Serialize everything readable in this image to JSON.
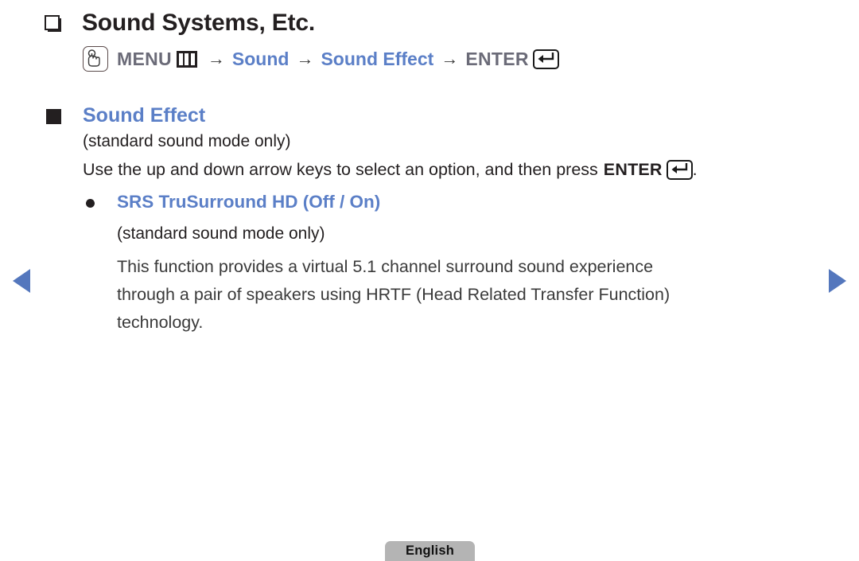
{
  "page": {
    "title": "Sound Systems, Etc.",
    "title_bullet_icon": "hollow-square-bullet-icon"
  },
  "breadcrumb": {
    "touch_icon": "hand-touch-icon",
    "menu_label": "MENU",
    "menu_glyph_icon": "menu-bars-icon",
    "arrow_1": "→",
    "link_1": "Sound",
    "arrow_2": "→",
    "link_2": "Sound Effect",
    "arrow_3": "→",
    "enter_label": "ENTER",
    "enter_glyph_icon": "enter-key-icon"
  },
  "section": {
    "bullet_icon": "filled-square-bullet-icon",
    "heading": "Sound Effect",
    "note": "(standard sound mode only)",
    "instruction_text": "Use the up and down arrow keys to select an option, and then press",
    "instruction_key": "ENTER",
    "instruction_key_icon": "enter-key-icon",
    "instruction_period": "."
  },
  "option": {
    "bullet_icon": "round-bullet-icon",
    "label": "SRS TruSurround HD (Off / On)",
    "note": "(standard sound mode only)",
    "description_lines": [
      "This function provides a virtual 5.1 channel surround sound experience",
      "through a pair of speakers using HRTF (Head Related Transfer Function)",
      "technology."
    ]
  },
  "navigation": {
    "prev_icon": "triangle-left-icon",
    "next_icon": "triangle-right-icon"
  },
  "footer": {
    "language": "English"
  },
  "colors": {
    "accent_blue": "#5b7fc7",
    "arrow_blue": "#5477bd",
    "text_dark": "#231f20",
    "menu_gray": "#6b6b78",
    "footer_gray": "#b4b4b4"
  }
}
